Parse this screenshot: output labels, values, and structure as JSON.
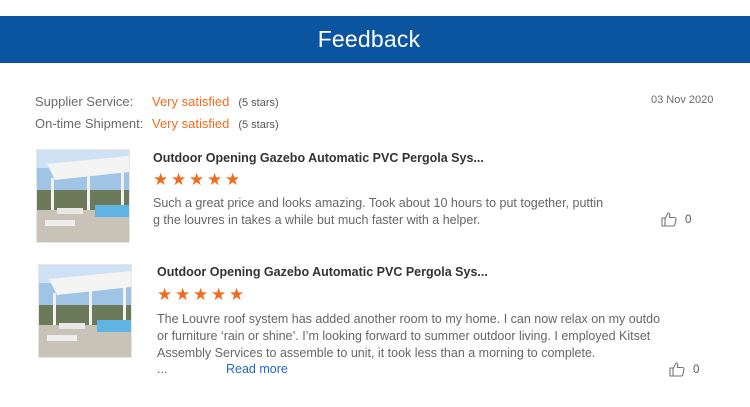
{
  "banner": {
    "title": "Feedback"
  },
  "ratings": [
    {
      "label": "Supplier Service:",
      "value": "Very satisfied",
      "stars": "(5 stars)"
    },
    {
      "label": "On-time Shipment:",
      "value": "Very satisfied",
      "stars": "(5 stars)"
    }
  ],
  "review_date": "03 Nov 2020",
  "reviews": [
    {
      "title": "Outdoor Opening Gazebo Automatic PVC Pergola Sys...",
      "rating": 5,
      "lines": [
        "Such a great price and looks amazing. Took about 10 hours to put together, puttin",
        "g the louvres in takes a while but much faster with a helper."
      ],
      "likes": "0",
      "thumb_icon": "thumbs-up-icon"
    },
    {
      "title": "Outdoor Opening Gazebo Automatic PVC Pergola Sys...",
      "rating": 5,
      "lines": [
        "The Louvre roof system has added another room to my home.  I can now relax on my outdo",
        "or furniture ‘rain or shine’.  I’m looking forward to summer outdoor living.  I employed Kitset",
        "Assembly Services to assemble to unit, it took less than a morning to complete."
      ],
      "ellipsis": "...",
      "read_more": "Read more",
      "likes": "0",
      "thumb_icon": "thumbs-up-icon"
    }
  ],
  "colors": {
    "banner": "#0b54a0",
    "accent_orange": "#f26b1d",
    "link_blue": "#1f69c6"
  }
}
